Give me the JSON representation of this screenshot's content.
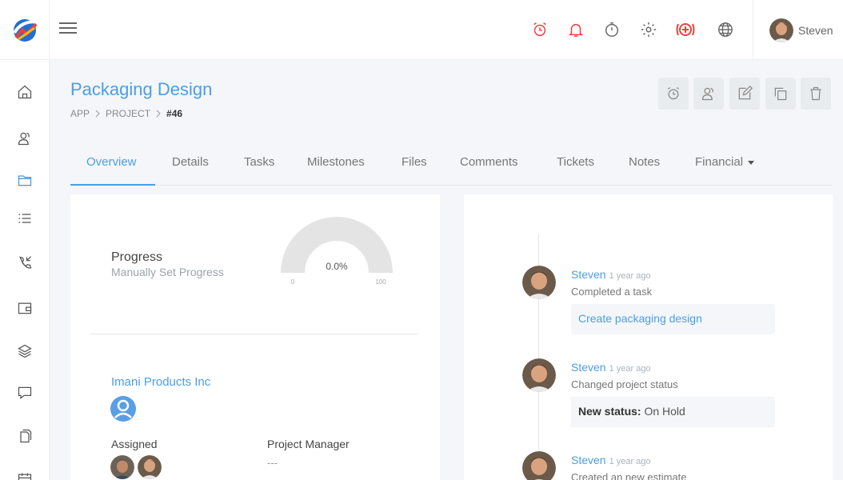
{
  "header": {
    "icons": [
      "alarm-clock-icon",
      "bell-icon",
      "stopwatch-icon",
      "gear-icon",
      "add-circle-icon",
      "globe-icon"
    ],
    "user_name": "Steven"
  },
  "sidebar": {
    "items": [
      "home-icon",
      "users-icon",
      "folder-icon",
      "list-icon",
      "phone-icon",
      "wallet-icon",
      "layers-icon",
      "chat-icon",
      "documents-icon",
      "calendar-icon"
    ]
  },
  "page": {
    "title": "Packaging Design",
    "breadcrumb": [
      "APP",
      "PROJECT",
      "#46"
    ]
  },
  "actions": [
    "timer-icon",
    "assign-user-icon",
    "edit-icon",
    "copy-icon",
    "trash-icon"
  ],
  "tabs": [
    {
      "label": "Overview",
      "active": true
    },
    {
      "label": "Details"
    },
    {
      "label": "Tasks"
    },
    {
      "label": "Milestones"
    },
    {
      "label": "Files"
    },
    {
      "label": "Comments"
    },
    {
      "label": "Tickets"
    },
    {
      "label": "Notes"
    },
    {
      "label": "Financial"
    }
  ],
  "overview": {
    "progress_title": "Progress",
    "progress_subtitle": "Manually Set Progress",
    "gauge": {
      "value": 0,
      "value_label": "0.0%",
      "min_label": "0",
      "max_label": "100"
    },
    "client_name": "Imani Products Inc",
    "assigned_label": "Assigned",
    "manager_label": "Project Manager",
    "manager_value": "---"
  },
  "timeline": [
    {
      "name": "Steven",
      "time": "1 year ago",
      "action": "Completed a task",
      "link": "Create packaging design"
    },
    {
      "name": "Steven",
      "time": "1 year ago",
      "action": "Changed project status",
      "status_label": "New status:",
      "status_value": "On Hold"
    },
    {
      "name": "Steven",
      "time": "1 year ago",
      "action": "Created an new estimate"
    }
  ],
  "colors": {
    "accent": "#4a9ee8",
    "alert_red": "#e8413e",
    "icon_gray": "#777777",
    "background": "#f4f6f9"
  }
}
